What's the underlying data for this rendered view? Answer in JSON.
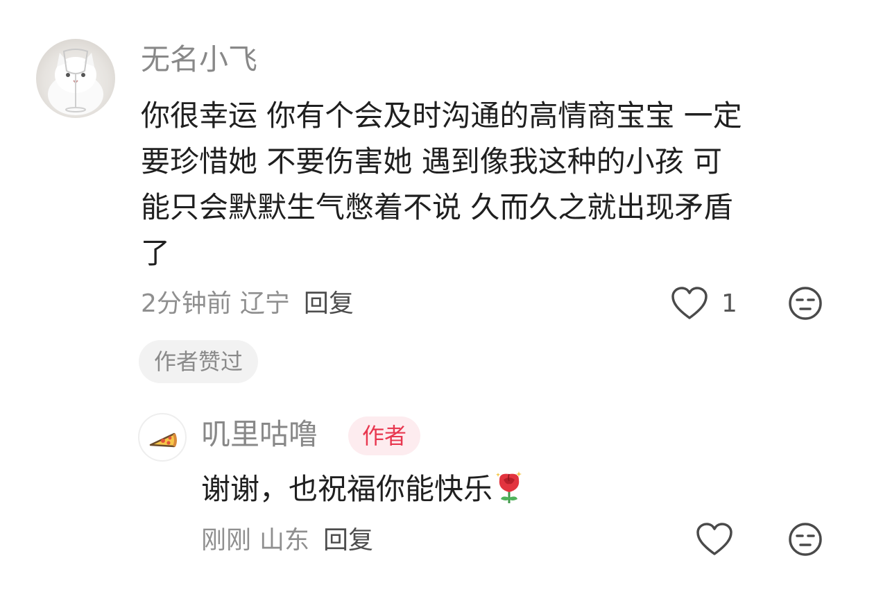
{
  "comment": {
    "avatar_icon": "cat-with-wine-glass-avatar",
    "username": "无名小飞",
    "lines": [
      "你很幸运 你有个会及时沟通的高情商宝宝 一定",
      "要珍惜她 不要伤害她 遇到像我这种的小孩 可",
      "能只会默默生气憋着不说 久而久之就出现矛盾",
      "了"
    ],
    "time": "2分钟前",
    "location": "辽宁",
    "reply_label": "回复",
    "like_icon": "heart-outline-icon",
    "like_count": "1",
    "emoji_icon": "expressionless-face-icon",
    "author_liked_badge": "作者赞过"
  },
  "reply": {
    "avatar_icon": "pizza-slice-avatar",
    "username": "叽里咕噜",
    "author_tag": "作者",
    "text": "谢谢，也祝福你能快乐",
    "text_emoji": "rose-icon",
    "time": "刚刚",
    "location": "山东",
    "reply_label": "回复",
    "like_icon": "heart-outline-icon",
    "emoji_icon": "expressionless-face-icon"
  },
  "colors": {
    "meta_gray": "#8f8f8f",
    "username_gray": "#888888",
    "author_tag_red": "#e8374f",
    "author_tag_bg": "#fdecef",
    "badge_bg": "#f2f2f2"
  }
}
